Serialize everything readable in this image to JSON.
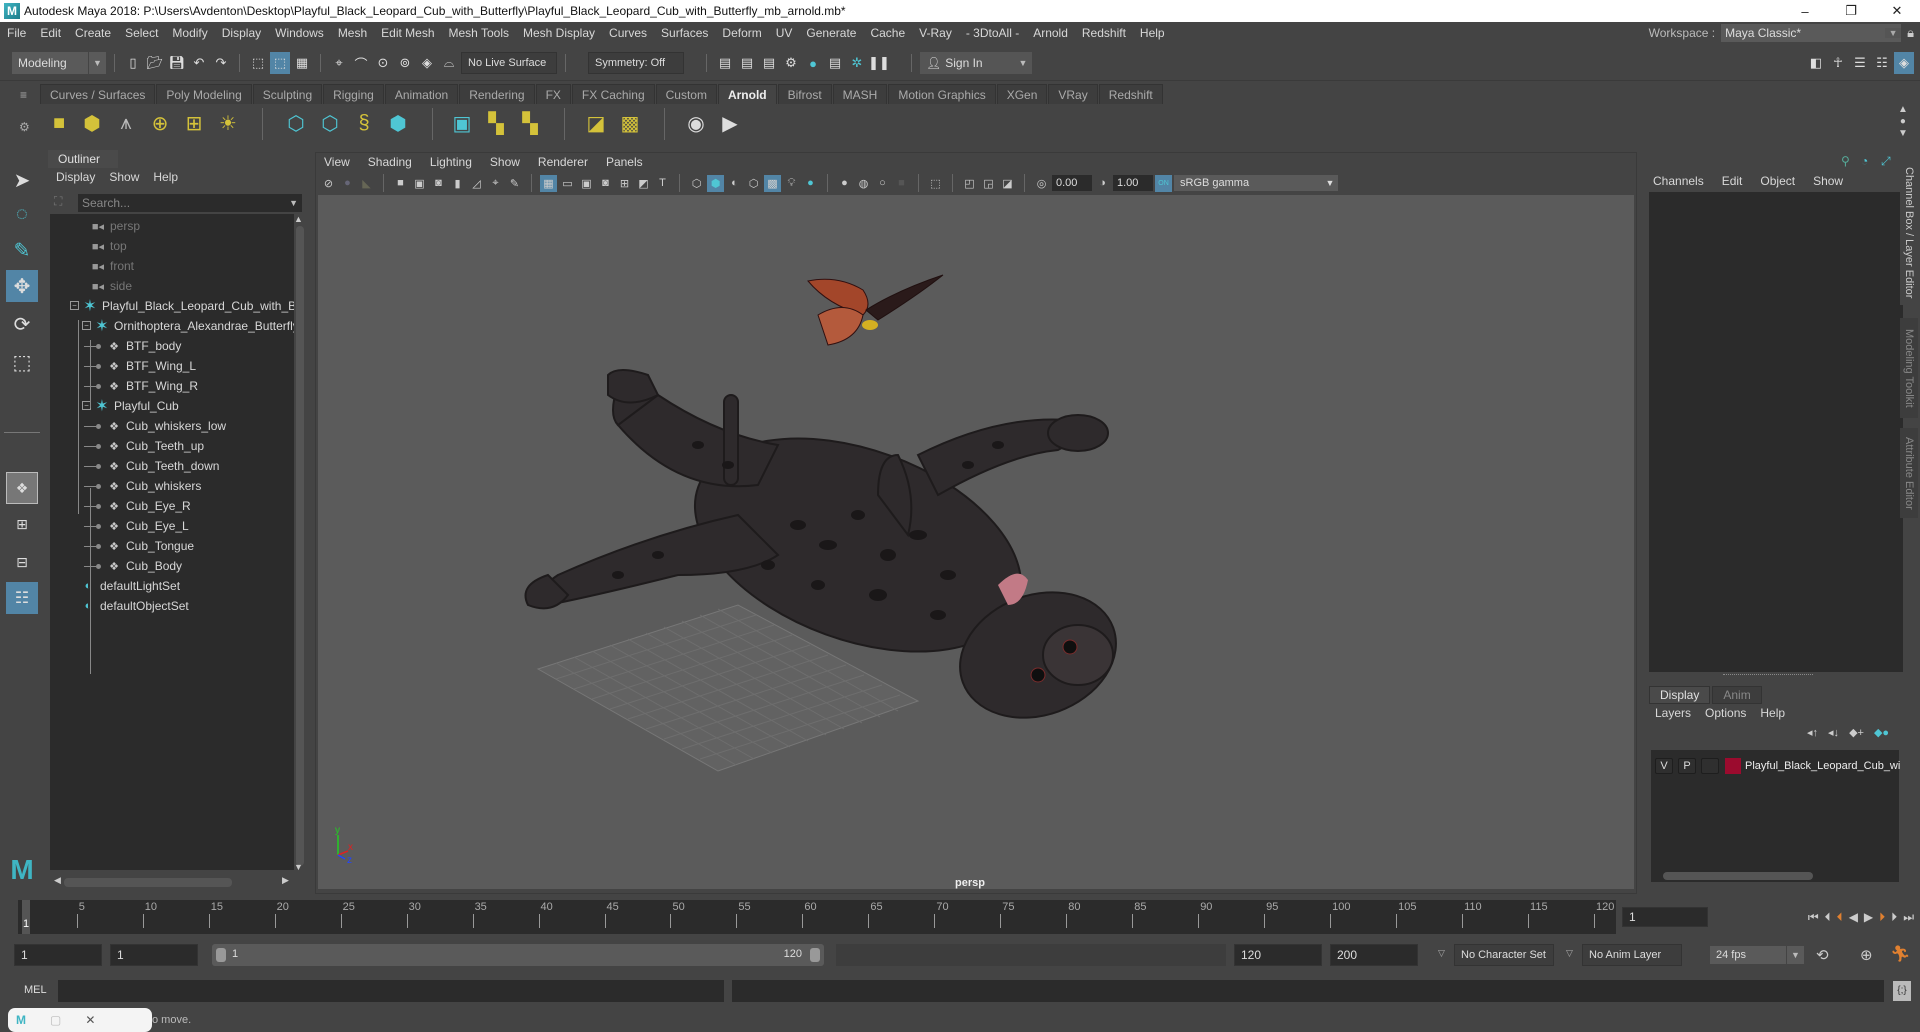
{
  "window": {
    "title": "Autodesk Maya 2018: P:\\Users\\Avdenton\\Desktop\\Playful_Black_Leopard_Cub_with_Butterfly\\Playful_Black_Leopard_Cub_with_Butterfly_mb_arnold.mb*",
    "minimize": "–",
    "maximize": "❐",
    "close": "✕"
  },
  "menubar": [
    "File",
    "Edit",
    "Create",
    "Select",
    "Modify",
    "Display",
    "Windows",
    "Mesh",
    "Edit Mesh",
    "Mesh Tools",
    "Mesh Display",
    "Curves",
    "Surfaces",
    "Deform",
    "UV",
    "Generate",
    "Cache",
    "V-Ray",
    "- 3DtoAll -",
    "Arnold",
    "Redshift",
    "Help"
  ],
  "workspace": {
    "label": "Workspace :",
    "value": "Maya Classic*"
  },
  "statusline": {
    "mode": "Modeling",
    "live_surface": "No Live Surface",
    "symmetry": "Symmetry: Off",
    "sign_in": "Sign In"
  },
  "shelf_tabs": [
    {
      "label": "Curves / Surfaces",
      "active": false
    },
    {
      "label": "Poly Modeling",
      "active": false
    },
    {
      "label": "Sculpting",
      "active": false
    },
    {
      "label": "Rigging",
      "active": false
    },
    {
      "label": "Animation",
      "active": false
    },
    {
      "label": "Rendering",
      "active": false
    },
    {
      "label": "FX",
      "active": false
    },
    {
      "label": "FX Caching",
      "active": false
    },
    {
      "label": "Custom",
      "active": false
    },
    {
      "label": "Arnold",
      "active": true
    },
    {
      "label": "Bifrost",
      "active": false
    },
    {
      "label": "MASH",
      "active": false
    },
    {
      "label": "Motion Graphics",
      "active": false
    },
    {
      "label": "XGen",
      "active": false
    },
    {
      "label": "VRay",
      "active": false
    },
    {
      "label": "Redshift",
      "active": false
    }
  ],
  "outliner": {
    "title": "Outliner",
    "menus": [
      "Display",
      "Show",
      "Help"
    ],
    "search_placeholder": "Search...",
    "items": [
      {
        "label": "persp",
        "type": "camera",
        "depth": 0
      },
      {
        "label": "top",
        "type": "camera",
        "depth": 0
      },
      {
        "label": "front",
        "type": "camera",
        "depth": 0
      },
      {
        "label": "side",
        "type": "camera",
        "depth": 0
      },
      {
        "label": "Playful_Black_Leopard_Cub_with_But",
        "type": "group",
        "depth": 0
      },
      {
        "label": "Ornithoptera_Alexandrae_Butterfly",
        "type": "group",
        "depth": 1
      },
      {
        "label": "BTF_body",
        "type": "mesh",
        "depth": 2
      },
      {
        "label": "BTF_Wing_L",
        "type": "mesh",
        "depth": 2
      },
      {
        "label": "BTF_Wing_R",
        "type": "mesh",
        "depth": 2
      },
      {
        "label": "Playful_Cub",
        "type": "group",
        "depth": 1
      },
      {
        "label": "Cub_whiskers_low",
        "type": "mesh",
        "depth": 2
      },
      {
        "label": "Cub_Teeth_up",
        "type": "mesh",
        "depth": 2
      },
      {
        "label": "Cub_Teeth_down",
        "type": "mesh",
        "depth": 2
      },
      {
        "label": "Cub_whiskers",
        "type": "mesh",
        "depth": 2
      },
      {
        "label": "Cub_Eye_R",
        "type": "mesh",
        "depth": 2
      },
      {
        "label": "Cub_Eye_L",
        "type": "mesh",
        "depth": 2
      },
      {
        "label": "Cub_Tongue",
        "type": "mesh",
        "depth": 2
      },
      {
        "label": "Cub_Body",
        "type": "mesh",
        "depth": 2
      },
      {
        "label": "defaultLightSet",
        "type": "set",
        "depth": 0
      },
      {
        "label": "defaultObjectSet",
        "type": "set",
        "depth": 0
      }
    ]
  },
  "viewport": {
    "menus": [
      "View",
      "Shading",
      "Lighting",
      "Show",
      "Renderer",
      "Panels"
    ],
    "exposure": "0.00",
    "gamma": "1.00",
    "color_mgmt_toggle": "ON",
    "color_space": "sRGB gamma",
    "camera_label": "persp",
    "axis": {
      "x": "x",
      "y": "y",
      "z": "z"
    }
  },
  "channel_box": {
    "menus": [
      "Channels",
      "Edit",
      "Object",
      "Show"
    ]
  },
  "layer_editor": {
    "tabs": [
      {
        "label": "Display",
        "active": true
      },
      {
        "label": "Anim",
        "active": false
      }
    ],
    "menus": [
      "Layers",
      "Options",
      "Help"
    ],
    "layers": [
      {
        "visible": "V",
        "playback": "P",
        "name": "Playful_Black_Leopard_Cub_wi",
        "color": "#9b0b2e"
      }
    ]
  },
  "side_tabs": [
    "Channel Box / Layer Editor",
    "Modeling Toolkit",
    "Attribute Editor"
  ],
  "timeline": {
    "ticks": [
      1,
      5,
      10,
      15,
      20,
      25,
      30,
      35,
      40,
      45,
      50,
      55,
      60,
      65,
      70,
      75,
      80,
      85,
      90,
      95,
      100,
      105,
      110,
      115,
      120
    ],
    "current_frame": "1",
    "current_frame_field": "1"
  },
  "range": {
    "start": "1",
    "anim_start": "1",
    "range_start": "1",
    "range_end": "120",
    "end": "120",
    "anim_end": "200",
    "character_set": "No Character Set",
    "anim_layer": "No Anim Layer",
    "fps": "24 fps"
  },
  "command_line": {
    "label": "MEL"
  },
  "help_line": {
    "text": "o move."
  },
  "colors": {
    "accent": "#5285a6",
    "arnold_teal": "#4fc6d4",
    "layer_color": "#9b0b2e"
  }
}
